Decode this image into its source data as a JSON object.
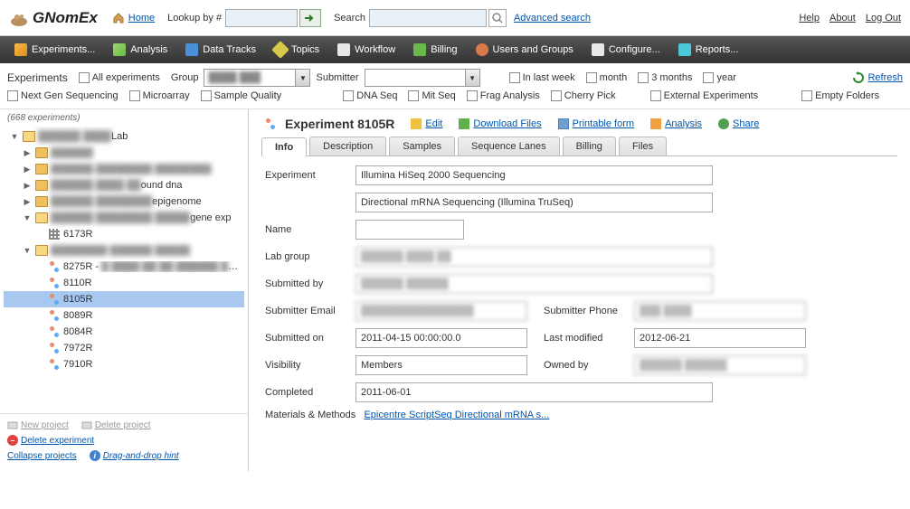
{
  "header": {
    "app_name": "GNomEx",
    "home": "Home",
    "lookup_label": "Lookup by #",
    "search_label": "Search",
    "advanced_search": "Advanced search",
    "help": "Help",
    "about": "About",
    "logout": "Log Out"
  },
  "menu": {
    "experiments": "Experiments...",
    "analysis": "Analysis",
    "data_tracks": "Data Tracks",
    "topics": "Topics",
    "workflow": "Workflow",
    "billing": "Billing",
    "users_groups": "Users and Groups",
    "configure": "Configure...",
    "reports": "Reports..."
  },
  "filters": {
    "title": "Experiments",
    "all_experiments": "All experiments",
    "group_label": "Group",
    "submitter_label": "Submitter",
    "last_week": "In last week",
    "month": "month",
    "three_months": "3 months",
    "year": "year",
    "refresh": "Refresh",
    "next_gen": "Next Gen Sequencing",
    "microarray": "Microarray",
    "sample_quality": "Sample Quality",
    "dna_seq": "DNA Seq",
    "mit_seq": "Mit Seq",
    "frag_analysis": "Frag Analysis",
    "cherry_pick": "Cherry Pick",
    "external_exp": "External Experiments",
    "empty_folders": "Empty Folders"
  },
  "sidebar": {
    "count": "(668 experiments)",
    "root_lab": "Lab",
    "folder_bound": "ound dna",
    "folder_epi": "epigenome",
    "folder_gene": "gene exp",
    "item_6173": "6173R",
    "item_8275": "8275R - ",
    "item_8110": "8110R",
    "item_8105": "8105R",
    "item_8089": "8089R",
    "item_8084": "8084R",
    "item_7972": "7972R",
    "item_7910": "7910R",
    "new_project": "New project",
    "delete_project": "Delete project",
    "delete_experiment": "Delete experiment",
    "collapse": "Collapse projects",
    "drag_hint": "Drag-and-drop hint"
  },
  "detail": {
    "title": "Experiment 8105R",
    "edit": "Edit",
    "download": "Download Files",
    "printable": "Printable form",
    "analysis": "Analysis",
    "share": "Share",
    "tabs": {
      "info": "Info",
      "description": "Description",
      "samples": "Samples",
      "seq_lanes": "Sequence Lanes",
      "billing": "Billing",
      "files": "Files"
    },
    "form": {
      "experiment_label": "Experiment",
      "experiment_value": "Illumina HiSeq 2000 Sequencing",
      "experiment_value2": "Directional mRNA Sequencing (Illumina TruSeq)",
      "name_label": "Name",
      "name_value": "",
      "lab_group_label": "Lab group",
      "submitted_by_label": "Submitted by",
      "submitter_email_label": "Submitter Email",
      "submitter_phone_label": "Submitter Phone",
      "submitted_on_label": "Submitted on",
      "submitted_on_value": "2011-04-15 00:00:00.0",
      "last_modified_label": "Last modified",
      "last_modified_value": "2012-06-21",
      "visibility_label": "Visibility",
      "visibility_value": "Members",
      "owned_by_label": "Owned by",
      "completed_label": "Completed",
      "completed_value": "2011-06-01",
      "materials_label": "Materials & Methods",
      "materials_link": "Epicentre ScriptSeq Directional mRNA s..."
    }
  }
}
